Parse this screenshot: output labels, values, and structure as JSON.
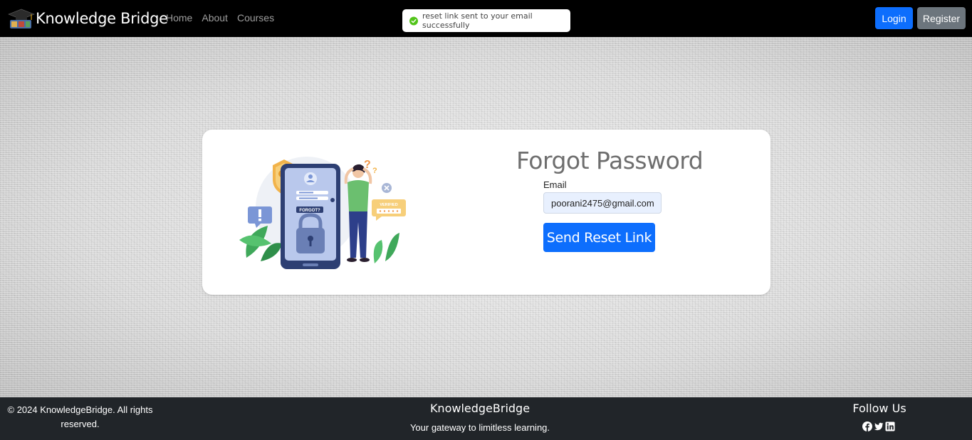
{
  "navbar": {
    "brand": "Knowledge Bridge",
    "links": [
      "Home",
      "About",
      "Courses"
    ],
    "login_label": "Login",
    "register_label": "Register"
  },
  "toast": {
    "message": "reset link sent to your email successfully",
    "status_color": "#52c41a"
  },
  "form": {
    "title": "Forgot Password",
    "email_label": "Email",
    "email_value": "poorani2475@gmail.com",
    "submit_label": "Send Reset Link"
  },
  "illustration": {
    "forgot_text": "FORGOT?",
    "verified_text": "VERIFIED"
  },
  "footer": {
    "copyright": "© 2024 KnowledgeBridge. All rights reserved.",
    "brand": "KnowledgeBridge",
    "tagline": "Your gateway to limitless learning.",
    "follow_title": "Follow Us",
    "social_icons": [
      "facebook-icon",
      "twitter-icon",
      "linkedin-icon"
    ]
  },
  "colors": {
    "primary": "#0d6efd",
    "secondary": "#6c757d",
    "footer_bg": "#212529",
    "navbar_bg": "#000000"
  }
}
